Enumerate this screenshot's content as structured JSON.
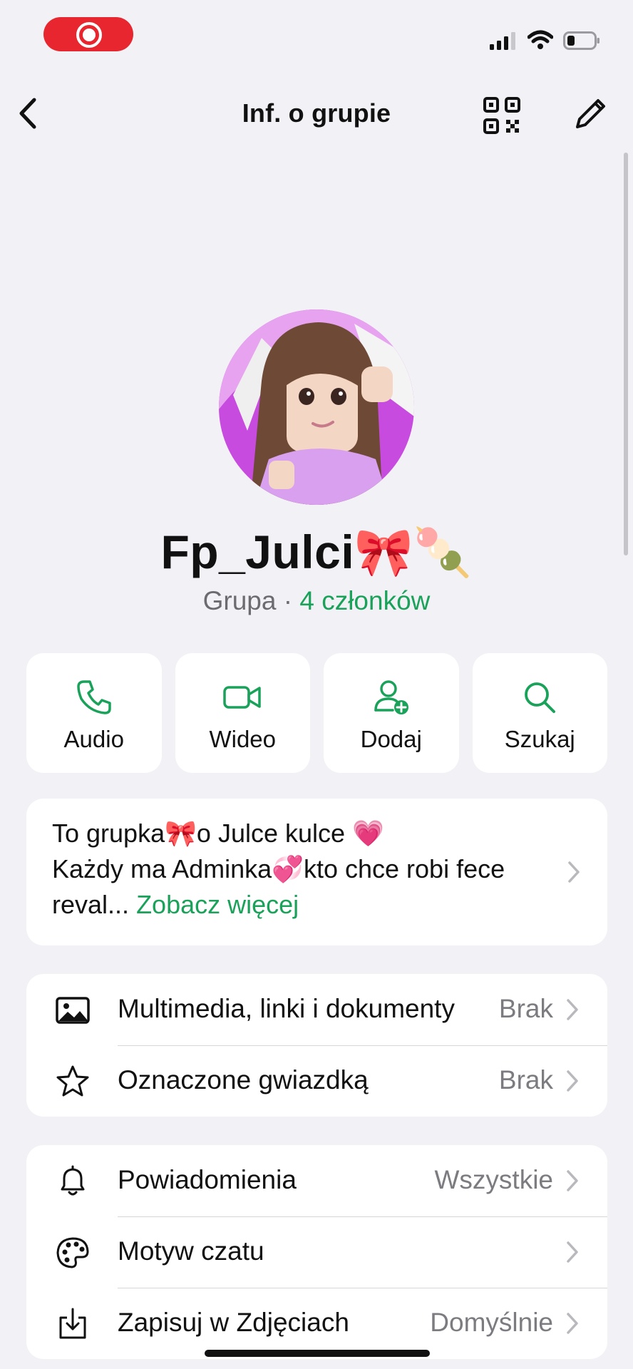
{
  "colors": {
    "accent": "#1aa15a",
    "background": "#f2f1f6",
    "record": "#e8262f",
    "secondary_text": "#7b7b80"
  },
  "nav": {
    "title": "Inf. o grupie"
  },
  "profile": {
    "name": "Fp_Julci🎀🍡",
    "type_label": "Grupa",
    "separator": " · ",
    "members": "4 członków"
  },
  "actions": [
    {
      "label": "Audio",
      "icon": "phone-icon"
    },
    {
      "label": "Wideo",
      "icon": "video-icon"
    },
    {
      "label": "Dodaj",
      "icon": "add-person-icon"
    },
    {
      "label": "Szukaj",
      "icon": "search-icon"
    }
  ],
  "description": {
    "line1": "To grupka🎀o Julce kulce 💗",
    "line2": "Każdy ma Adminka💞kto chce robi fece",
    "line3": "reval...",
    "see_more": "Zobacz więcej"
  },
  "media_section": [
    {
      "label": "Multimedia, linki i dokumenty",
      "value": "Brak",
      "icon": "photo-icon"
    },
    {
      "label": "Oznaczone gwiazdką",
      "value": "Brak",
      "icon": "star-icon"
    }
  ],
  "settings_section": [
    {
      "label": "Powiadomienia",
      "value": "Wszystkie",
      "icon": "bell-icon"
    },
    {
      "label": "Motyw czatu",
      "value": "",
      "icon": "palette-icon"
    },
    {
      "label": "Zapisuj w Zdjęciach",
      "value": "Domyślnie",
      "icon": "download-icon"
    }
  ]
}
